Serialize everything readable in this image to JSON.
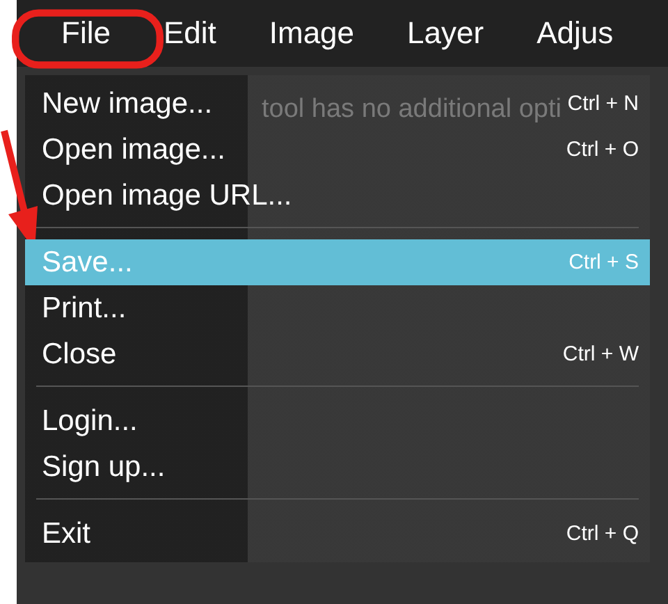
{
  "menu_bar": [
    {
      "label": "File"
    },
    {
      "label": "Edit"
    },
    {
      "label": "Image"
    },
    {
      "label": "Layer"
    },
    {
      "label": "Adjus"
    }
  ],
  "options_bar": {
    "text": "tool has no additional opti"
  },
  "file_menu": [
    {
      "kind": "item",
      "label": "New image...",
      "shortcut": "Ctrl + N",
      "selected": false
    },
    {
      "kind": "item",
      "label": "Open image...",
      "shortcut": "Ctrl + O",
      "selected": false
    },
    {
      "kind": "item",
      "label": "Open image URL...",
      "selected": false
    },
    {
      "kind": "separator"
    },
    {
      "kind": "item",
      "label": "Save...",
      "shortcut": "Ctrl + S",
      "selected": true
    },
    {
      "kind": "item",
      "label": "Print...",
      "selected": false
    },
    {
      "kind": "item",
      "label": "Close",
      "shortcut": "Ctrl + W",
      "selected": false
    },
    {
      "kind": "separator"
    },
    {
      "kind": "item",
      "label": "Login...",
      "selected": false
    },
    {
      "kind": "item",
      "label": "Sign up...",
      "selected": false
    },
    {
      "kind": "separator"
    },
    {
      "kind": "item",
      "label": "Exit",
      "shortcut": "Ctrl + Q",
      "selected": false
    }
  ]
}
